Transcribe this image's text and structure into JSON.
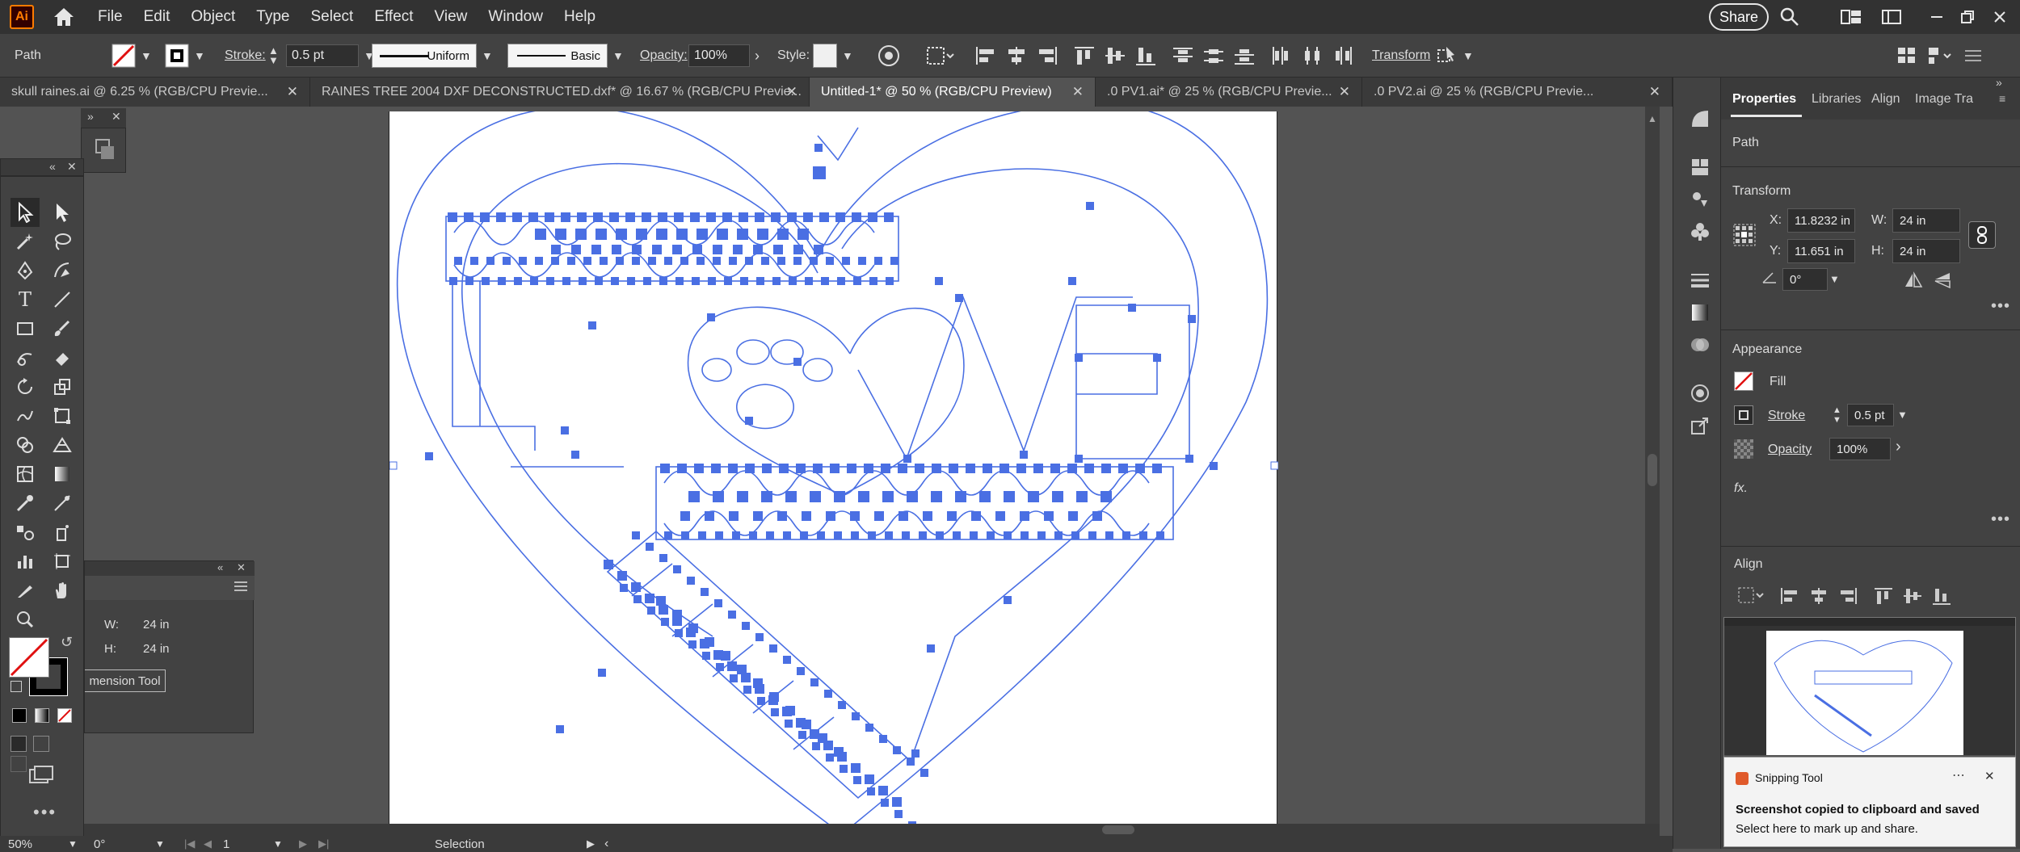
{
  "app": {
    "logo": "Ai"
  },
  "menu": [
    "File",
    "Edit",
    "Object",
    "Type",
    "Select",
    "Effect",
    "View",
    "Window",
    "Help"
  ],
  "topbar": {
    "share_label": "Share"
  },
  "control": {
    "object_type": "Path",
    "stroke_label": "Stroke:",
    "stroke_value": "0.5 pt",
    "profile_uniform": "Uniform",
    "brush_basic": "Basic",
    "opacity_label": "Opacity:",
    "opacity_value": "100%",
    "style_label": "Style:",
    "transform_label": "Transform"
  },
  "tabs": [
    {
      "label": "skull raines.ai @ 6.25 % (RGB/CPU Previe...",
      "active": false
    },
    {
      "label": "RAINES TREE 2004 DXF DECONSTRUCTED.dxf* @ 16.67 % (RGB/CPU Previe...",
      "active": false
    },
    {
      "label": "Untitled-1* @ 50 % (RGB/CPU Preview)",
      "active": true
    },
    {
      "label": ".0 PV1.ai* @ 25 % (RGB/CPU Previe...",
      "active": false
    },
    {
      "label": ".0 PV2.ai @ 25 % (RGB/CPU Previe...",
      "active": false
    }
  ],
  "panel": {
    "tabs": [
      "Properties",
      "Libraries",
      "Align",
      "Image Tra"
    ],
    "object_type": "Path",
    "transform_title": "Transform",
    "x_label": "X:",
    "x_value": "11.8232 in",
    "y_label": "Y:",
    "y_value": "11.651 in",
    "w_label": "W:",
    "w_value": "24 in",
    "h_label": "H:",
    "h_value": "24 in",
    "angle_value": "0°",
    "appearance_title": "Appearance",
    "fill_label": "Fill",
    "stroke_label": "Stroke",
    "stroke_value": "0.5 pt",
    "opacity_label": "Opacity",
    "opacity_value": "100%",
    "fx_label": "fx.",
    "align_title": "Align"
  },
  "floating": {
    "w_label": "W:",
    "w_value": "24 in",
    "h_label": "H:",
    "h_value": "24 in",
    "button_label": "mension Tool"
  },
  "status": {
    "zoom": "50%",
    "rotation": "0°",
    "artboard": "1",
    "mode": "Selection"
  },
  "toast": {
    "app": "Snipping Tool",
    "title": "Screenshot copied to clipboard and saved",
    "body": "Select here to mark up and share."
  },
  "colors": {
    "selection": "#4a6fe3",
    "accent": "#ff7c00"
  }
}
